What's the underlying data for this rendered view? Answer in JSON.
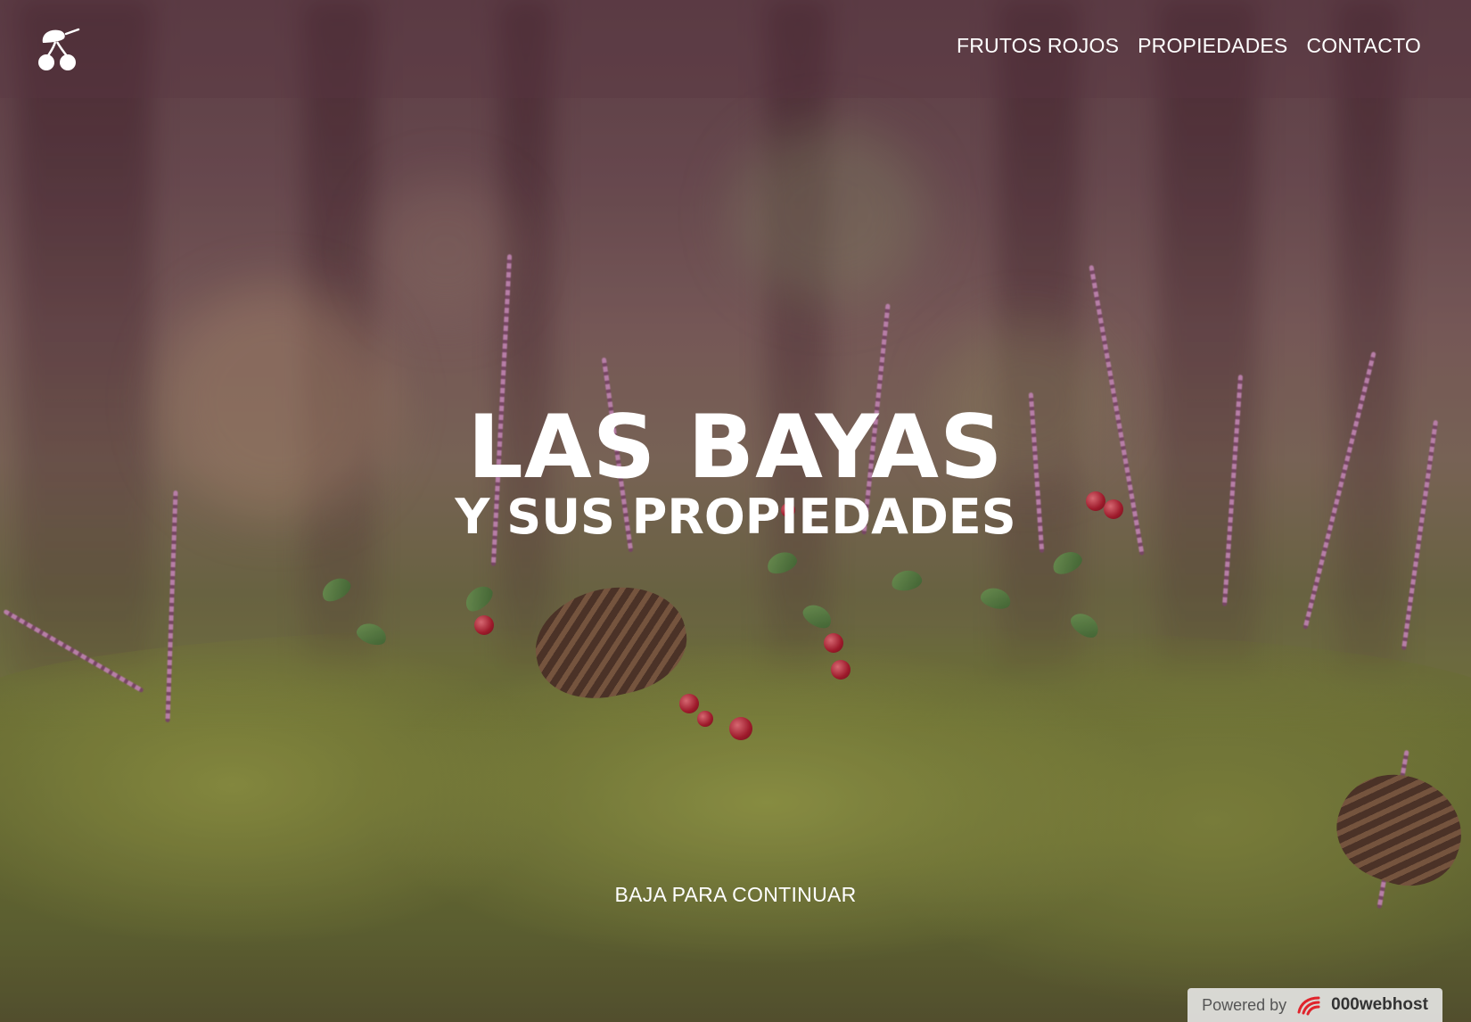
{
  "header": {
    "logo_icon": "cherries-icon",
    "nav": [
      {
        "label": "FRUTOS ROJOS"
      },
      {
        "label": "PROPIEDADES"
      },
      {
        "label": "CONTACTO"
      }
    ]
  },
  "hero": {
    "title": "LAS BAYAS",
    "subtitle": "Y SUS PROPIEDADES",
    "scroll_hint": "BAJA PARA CONTINUAR"
  },
  "footer_badge": {
    "prefix": "Powered by",
    "brand": "000webhost",
    "icon": "webhost-logo-icon"
  },
  "colors": {
    "text": "#ffffff",
    "header_tint": "#5a3741",
    "berry_red": "#a8182a",
    "moss_green": "#8a9440"
  }
}
